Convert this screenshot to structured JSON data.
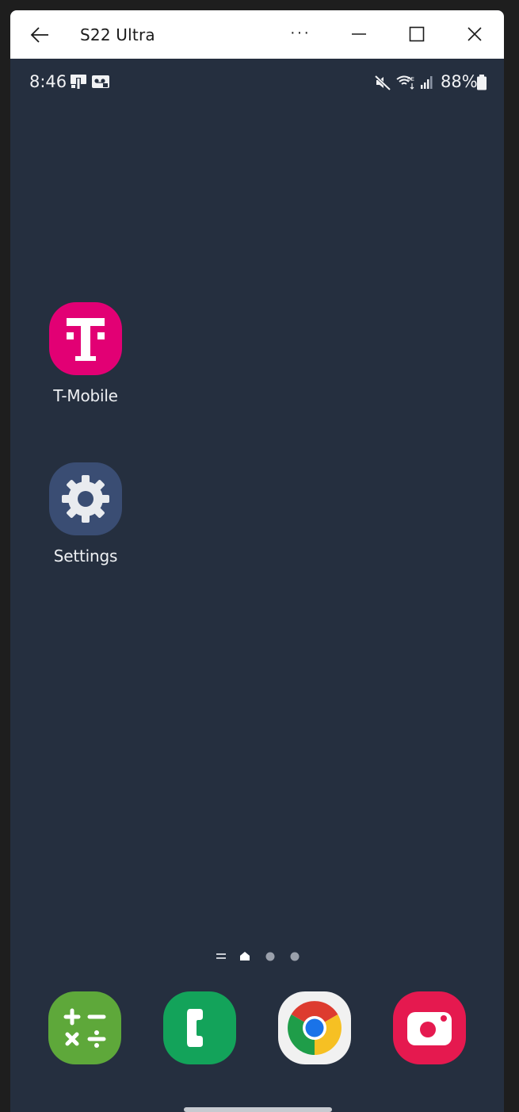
{
  "window": {
    "title": "S22 Ultra",
    "more_label": "···"
  },
  "status_bar": {
    "time": "8:46",
    "battery": "88%",
    "icons": [
      "cast-icon",
      "voicemail-icon",
      "mute-icon",
      "wifi-6e-icon",
      "signal-icon",
      "battery-icon"
    ]
  },
  "home_screen": {
    "apps": [
      {
        "label": "T-Mobile",
        "icon": "t-mobile-icon",
        "color": "#e20074"
      },
      {
        "label": "Settings",
        "icon": "settings-gear-icon",
        "color": "#3a4d73"
      }
    ],
    "page_indicator": {
      "pages": 3,
      "current": "home"
    }
  },
  "dock": {
    "apps": [
      {
        "icon": "calculator-icon",
        "color": "#5ea83a"
      },
      {
        "icon": "phone-icon",
        "color": "#13a35a"
      },
      {
        "icon": "chrome-icon",
        "color": "#f1f1f1"
      },
      {
        "icon": "camera-icon",
        "color": "#e5194f"
      }
    ]
  }
}
